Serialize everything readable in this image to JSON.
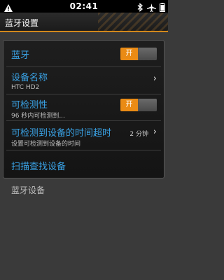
{
  "status_bar": {
    "time": "02:41",
    "icons": [
      "warning-icon",
      "bluetooth-icon",
      "airplane-icon",
      "battery-icon"
    ]
  },
  "title_bar": {
    "title": "蓝牙设置"
  },
  "settings": {
    "bluetooth": {
      "label": "蓝牙",
      "toggle_label": "开"
    },
    "device_name": {
      "label": "设备名称",
      "value": "HTC HD2"
    },
    "discoverable": {
      "label": "可检测性",
      "summary": "96 秒内可检测到...",
      "toggle_label": "开"
    },
    "discoverable_timeout": {
      "label": "可检测到设备的时间超时",
      "summary": "设置可检测到设备的时间",
      "value": "2 分钟"
    },
    "scan": {
      "label": "扫描查找设备"
    }
  },
  "devices_section": {
    "header": "蓝牙设备"
  },
  "colors": {
    "accent": "#ea8b15",
    "label_blue": "#3aa4e8",
    "background": "#3a3a3a"
  }
}
